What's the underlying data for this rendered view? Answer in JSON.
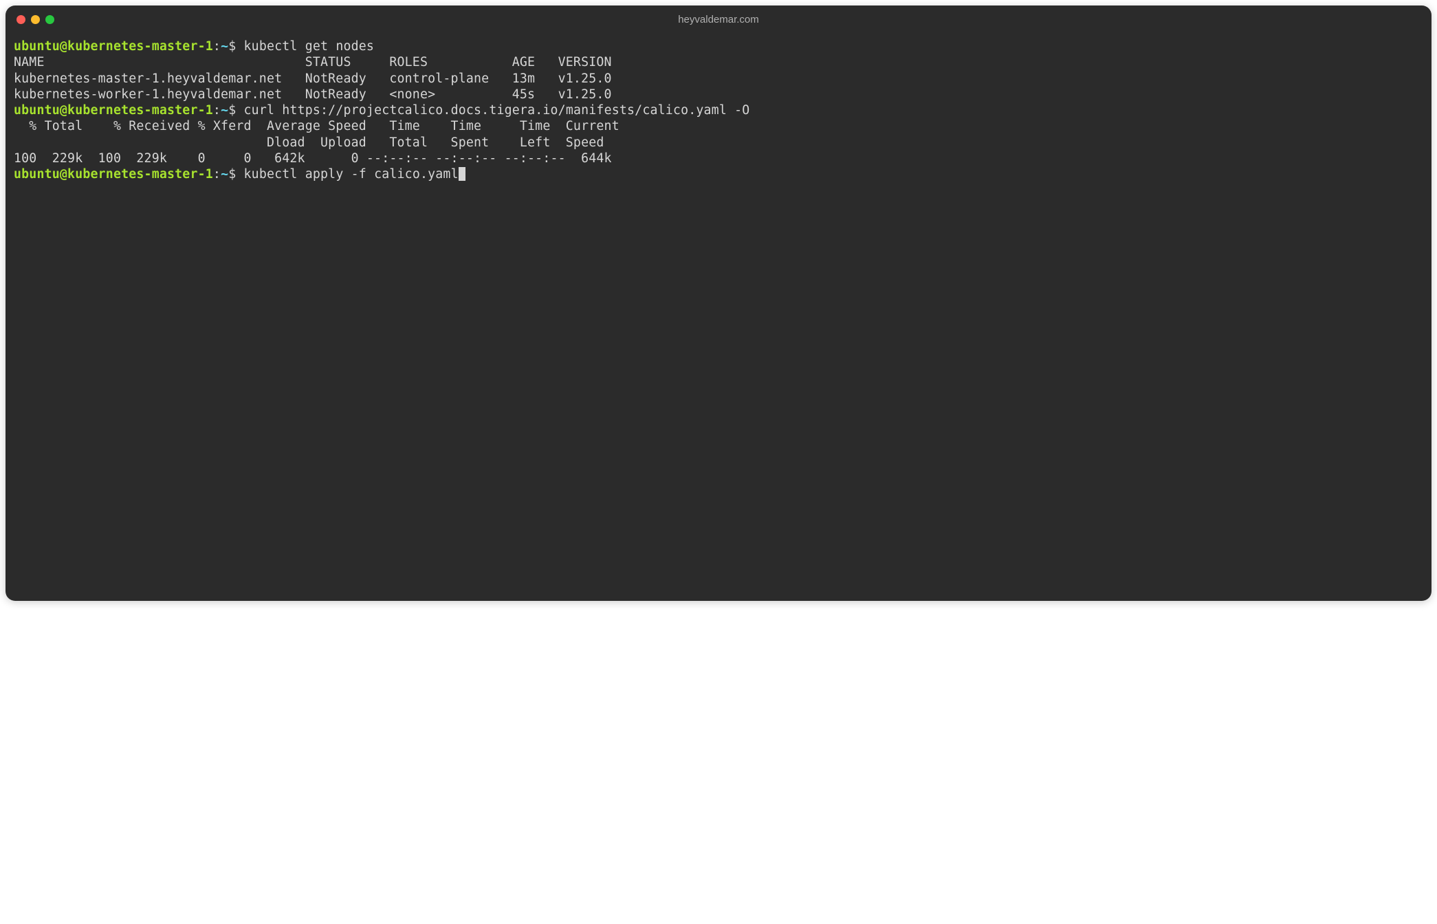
{
  "window": {
    "title": "heyvaldemar.com"
  },
  "prompt": {
    "user_host": "ubuntu@kubernetes-master-1",
    "colon": ":",
    "path": "~",
    "dollar": "$"
  },
  "lines": {
    "cmd1": "kubectl get nodes",
    "nodes_header": "NAME                                  STATUS     ROLES           AGE   VERSION",
    "nodes_row1": "kubernetes-master-1.heyvaldemar.net   NotReady   control-plane   13m   v1.25.0",
    "nodes_row2": "kubernetes-worker-1.heyvaldemar.net   NotReady   <none>          45s   v1.25.0",
    "cmd2": "curl https://projectcalico.docs.tigera.io/manifests/calico.yaml -O",
    "curl_header1": "  % Total    % Received % Xferd  Average Speed   Time    Time     Time  Current",
    "curl_header2": "                                 Dload  Upload   Total   Spent    Left  Speed",
    "curl_row": "100  229k  100  229k    0     0   642k      0 --:--:-- --:--:-- --:--:--  644k",
    "cmd3": "kubectl apply -f calico.yaml"
  }
}
